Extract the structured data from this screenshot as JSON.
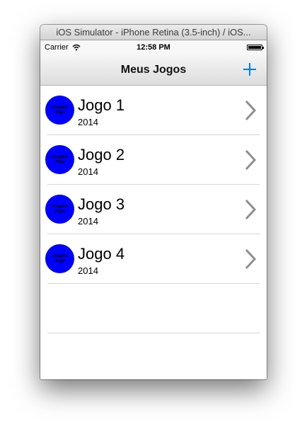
{
  "window": {
    "title": "iOS Simulator - iPhone Retina (3.5-inch) / iOS..."
  },
  "statusbar": {
    "carrier": "Carrier",
    "time": "12:58 PM",
    "battery_icon": "battery-icon",
    "wifi_icon": "wifi-icon"
  },
  "navbar": {
    "title": "Meus Jogos",
    "add_icon": "plus-icon",
    "accent_color": "#007aff"
  },
  "games": [
    {
      "title": "Jogo 1",
      "year": "2014",
      "thumb_line1": "Imagem",
      "thumb_line2": "Jogo"
    },
    {
      "title": "Jogo 2",
      "year": "2014",
      "thumb_line1": "Imagem",
      "thumb_line2": "Jogo"
    },
    {
      "title": "Jogo 3",
      "year": "2014",
      "thumb_line1": "Imagem",
      "thumb_line2": "Jogo"
    },
    {
      "title": "Jogo 4",
      "year": "2014",
      "thumb_line1": "Imagem",
      "thumb_line2": "Jogo"
    }
  ],
  "colors": {
    "thumb": "#0000ff",
    "chevron": "#8e8e93"
  }
}
